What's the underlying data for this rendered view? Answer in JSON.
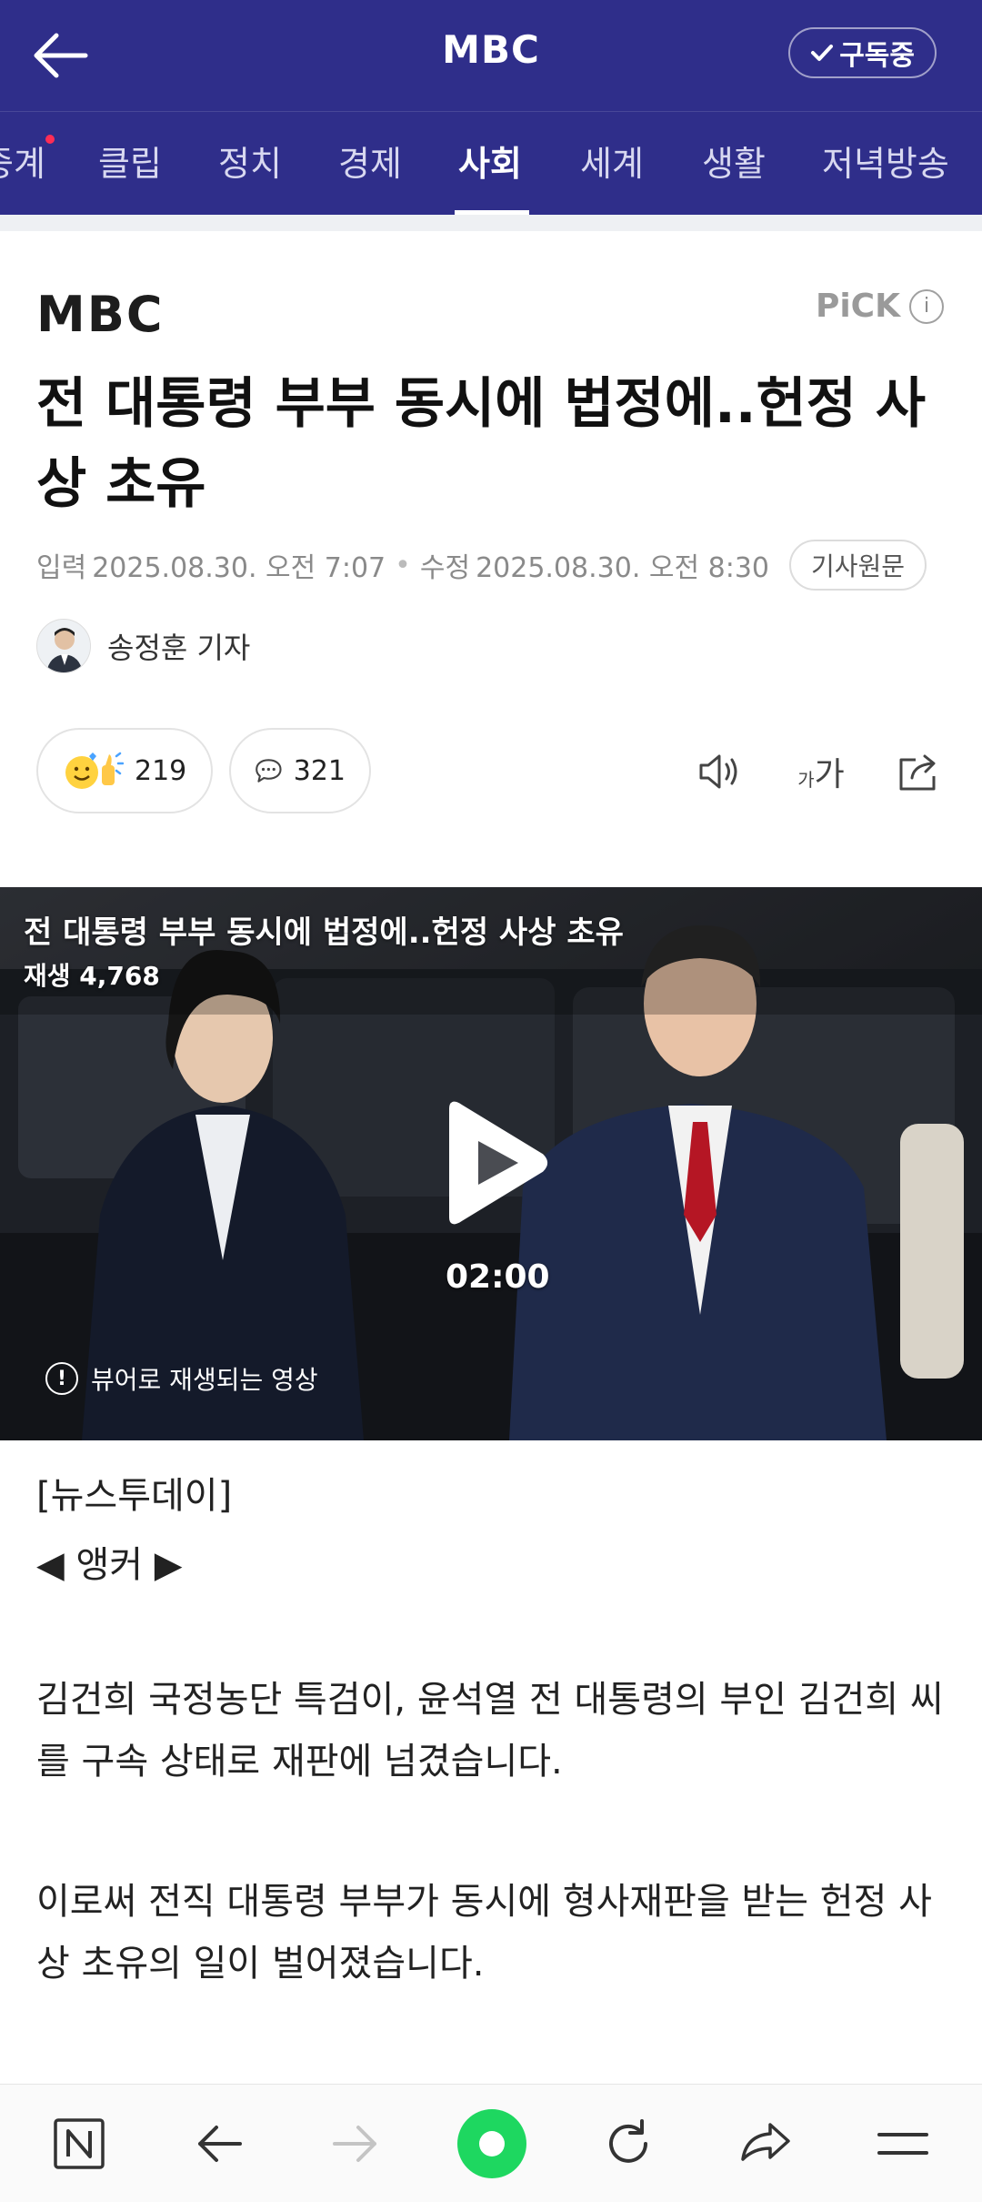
{
  "header": {
    "title": "MBC",
    "subscribe_label": "구독중"
  },
  "tabs": [
    {
      "label": "중계"
    },
    {
      "label": "클립"
    },
    {
      "label": "정치"
    },
    {
      "label": "경제"
    },
    {
      "label": "사회",
      "active": true
    },
    {
      "label": "세계"
    },
    {
      "label": "생활"
    },
    {
      "label": "저녁방송"
    }
  ],
  "article": {
    "press_logo": "MBC",
    "pick_label": "PiCK",
    "headline": "전 대통령 부부 동시에 법정에..헌정 사상 초유",
    "input_label": "입력",
    "input_time": "2025.08.30. 오전 7:07",
    "modified_label": "수정",
    "modified_time": "2025.08.30. 오전 8:30",
    "original_label": "기사원문",
    "reporter": "송정훈 기자",
    "reaction_count": "219",
    "comment_count": "321",
    "font_size_label_small": "가",
    "font_size_label_large": "가"
  },
  "video": {
    "title": "전 대통령 부부 동시에 법정에..헌정 사상 초유",
    "views": "재생 4,768",
    "duration": "02:00",
    "notice": "뷰어로 재생되는 영상"
  },
  "body": {
    "program": "[뉴스투데이]",
    "anchor": "◀ 앵커 ▶",
    "paragraph1": "김건희 국정농단 특검이, 윤석열 전 대통령의 부인 김건희 씨를 구속 상태로 재판에 넘겼습니다.",
    "paragraph2": "이로써 전직 대통령 부부가 동시에 형사재판을 받는 헌정 사상 초유의 일이 벌어졌습니다."
  },
  "colors": {
    "header_bg": "#2f2e8a",
    "notification_dot": "#ff2d55",
    "home_green": "#1ed760"
  }
}
